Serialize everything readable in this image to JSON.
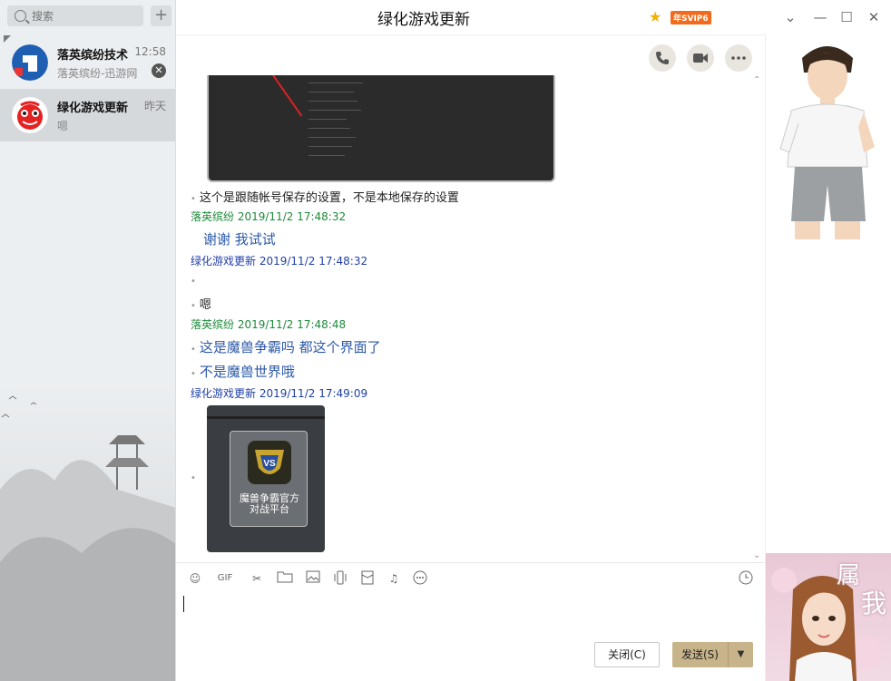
{
  "sidebar": {
    "search_placeholder": "搜索",
    "conversations": [
      {
        "name": "落英缤纷技术",
        "time": "12:58",
        "preview": "落英缤纷-迅游网"
      },
      {
        "name": "绿化游戏更新",
        "time": "昨天",
        "preview": "嗯"
      }
    ]
  },
  "header": {
    "title": "绿化游戏更新",
    "badge": "年SVIP6"
  },
  "chat": {
    "messages": [
      {
        "text": "这个是跟随帐号保存的设置，不是本地保存的设置"
      },
      {
        "sender": "落英缤纷",
        "time": "2019/11/2 17:48:32"
      },
      {
        "text": "谢谢 我试试"
      },
      {
        "sender": "绿化游戏更新",
        "time": "2019/11/2 17:48:32"
      },
      {
        "text": "嗯"
      },
      {
        "sender": "落英缤纷",
        "time": "2019/11/2 17:48:48"
      },
      {
        "text": "这是魔兽争霸吗 都这个界面了"
      },
      {
        "text": "不是魔兽世界哦"
      },
      {
        "sender": "绿化游戏更新",
        "time": "2019/11/2 17:49:09"
      }
    ],
    "card_label_line1": "魔兽争霸官方",
    "card_label_line2": "对战平台"
  },
  "composer": {
    "close_label": "关闭(C)",
    "send_label": "发送(S)"
  },
  "show_panel": {
    "banner_word1": "属",
    "banner_word2": "我"
  },
  "colors": {
    "sender_green": "#1d8a3a",
    "sender_blue": "#1f3fa8",
    "message_blue": "#2d5aa8",
    "send_button": "#c8b48a",
    "vip_badge": "#f26b1d"
  },
  "icons": [
    "search-icon",
    "plus-icon",
    "phone-icon",
    "video-icon",
    "more-icon",
    "emoji-icon",
    "gif-icon",
    "scissors-icon",
    "folder-icon",
    "image-icon",
    "shake-icon",
    "red-packet-icon",
    "music-icon",
    "more-options-icon",
    "history-clock-icon",
    "minimize-chevron-icon",
    "min-icon",
    "max-icon",
    "close-icon"
  ]
}
